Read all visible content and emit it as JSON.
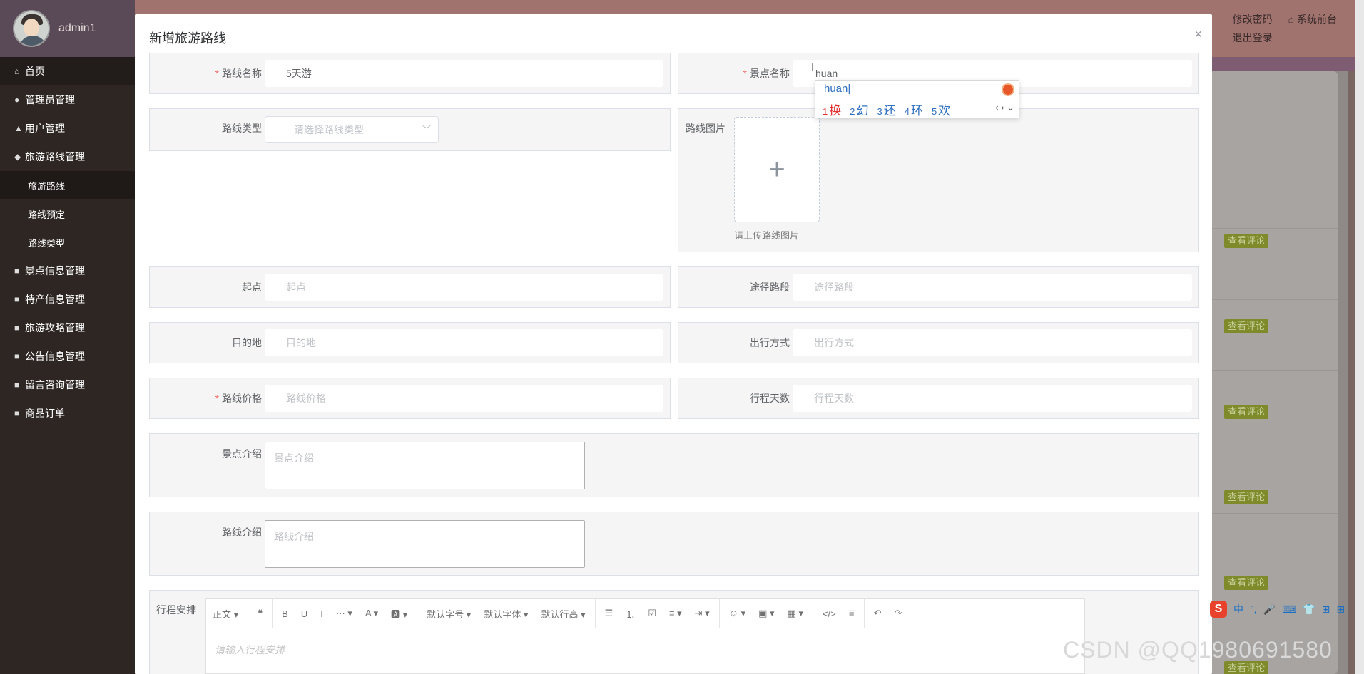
{
  "sidebar": {
    "user_name": "admin1",
    "items": [
      {
        "label": "首页",
        "icon": "home-icon",
        "glyph": "⌂"
      },
      {
        "label": "管理员管理",
        "icon": "admin-icon",
        "glyph": "●"
      },
      {
        "label": "用户管理",
        "icon": "user-icon",
        "glyph": "▲"
      },
      {
        "label": "旅游路线管理",
        "icon": "route-icon",
        "glyph": "◆"
      },
      {
        "label": "旅游路线",
        "sub": true,
        "active": true
      },
      {
        "label": "路线预定",
        "sub": true
      },
      {
        "label": "路线类型",
        "sub": true
      },
      {
        "label": "景点信息管理",
        "icon": "scenic-icon",
        "glyph": "■"
      },
      {
        "label": "特产信息管理",
        "icon": "specialty-icon",
        "glyph": "■"
      },
      {
        "label": "旅游攻略管理",
        "icon": "guide-icon",
        "glyph": "■"
      },
      {
        "label": "公告信息管理",
        "icon": "notice-icon",
        "glyph": "■"
      },
      {
        "label": "留言咨询管理",
        "icon": "message-icon",
        "glyph": "■"
      },
      {
        "label": "商品订单",
        "icon": "order-icon",
        "glyph": "■"
      }
    ]
  },
  "topbar": {
    "change_password": "修改密码",
    "front_site": "系统前台",
    "logout": "退出登录"
  },
  "background": {
    "view_comment": "查看评论"
  },
  "modal": {
    "title": "新增旅游路线",
    "close": "×",
    "fields": {
      "route_name": {
        "label": "路线名称",
        "value": "5天游",
        "required": true
      },
      "scenic_name": {
        "label": "景点名称",
        "value": "huan",
        "required": true
      },
      "route_type": {
        "label": "路线类型",
        "placeholder": "请选择路线类型"
      },
      "route_image": {
        "label": "路线图片",
        "tip": "请上传路线图片",
        "plus": "+"
      },
      "start": {
        "label": "起点",
        "placeholder": "起点"
      },
      "via": {
        "label": "途径路段",
        "placeholder": "途径路段"
      },
      "destination": {
        "label": "目的地",
        "placeholder": "目的地"
      },
      "travel_mode": {
        "label": "出行方式",
        "placeholder": "出行方式"
      },
      "price": {
        "label": "路线价格",
        "placeholder": "路线价格",
        "required": true
      },
      "days": {
        "label": "行程天数",
        "placeholder": "行程天数"
      },
      "scenic_intro": {
        "label": "景点介绍",
        "placeholder": "景点介绍"
      },
      "route_intro": {
        "label": "路线介绍",
        "placeholder": "路线介绍"
      },
      "itinerary": {
        "label": "行程安排",
        "placeholder": "请输入行程安排"
      }
    },
    "editor_toolbar": [
      "正文 ▾",
      "❝",
      "B",
      "U",
      "I",
      "··· ▾",
      "A ▾",
      "🅰 ▾",
      "默认字号 ▾",
      "默认字体 ▾",
      "默认行高 ▾",
      "☰",
      "⒈",
      "☑",
      "≡ ▾",
      "⇥ ▾",
      "☺ ▾",
      "▣ ▾",
      "▦ ▾",
      "</>",
      "⩸",
      "↶",
      "↷"
    ]
  },
  "ime": {
    "composition": "huan",
    "candidates": [
      {
        "n": "1",
        "c": "换"
      },
      {
        "n": "2",
        "c": "幻"
      },
      {
        "n": "3",
        "c": "还"
      },
      {
        "n": "4",
        "c": "环"
      },
      {
        "n": "5",
        "c": "欢"
      }
    ],
    "nav": "‹ › ⌄"
  },
  "imebar": {
    "logo": "S",
    "lang": "中",
    "punct": "°,",
    "mic": "🎤",
    "kbd": "⌨",
    "skin": "👕",
    "game": "⊞",
    "grid": "⊞"
  },
  "watermark": "CSDN @QQ1980691580",
  "colors": {
    "sidebar": "#2e2623",
    "topbar": "#a0736f",
    "required": "#f56c6c",
    "ime_blue": "#2f6fbf",
    "badge": "#7f8a2a"
  }
}
